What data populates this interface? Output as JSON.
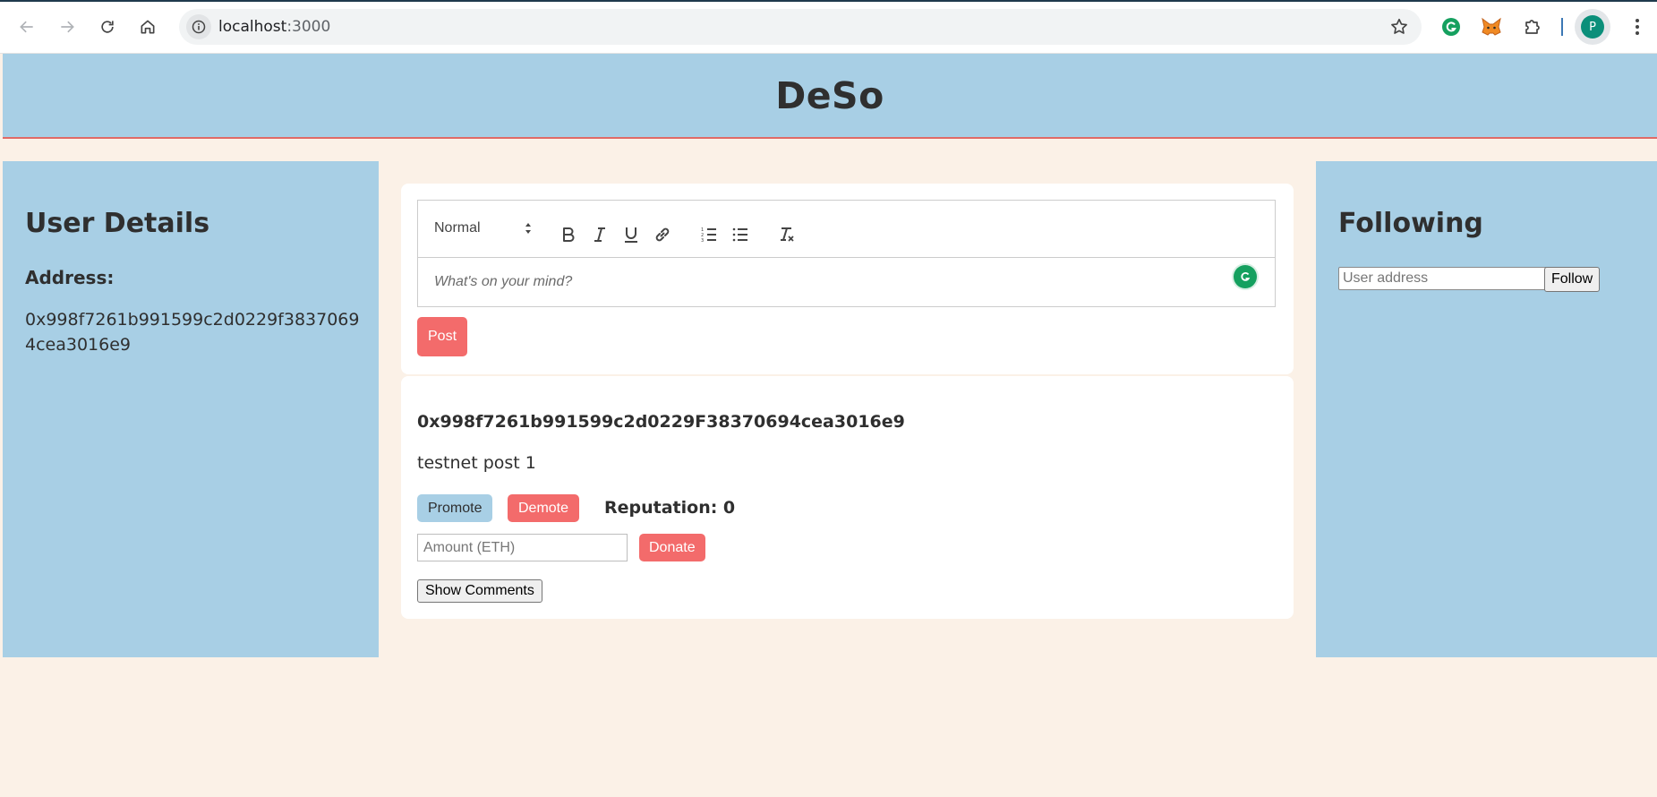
{
  "browser": {
    "url_host": "localhost",
    "url_port": ":3000",
    "profile_initial": "P"
  },
  "header": {
    "title": "DeSo"
  },
  "user_details": {
    "title": "User Details",
    "address_label": "Address:",
    "address_value": "0x998f7261b991599c2d0229f38370694cea3016e9"
  },
  "composer": {
    "format_option": "Normal",
    "placeholder": "What's on your mind?",
    "post_label": "Post",
    "toolbar_icons": [
      "bold-icon",
      "italic-icon",
      "underline-icon",
      "link-icon",
      "ordered-list-icon",
      "bullet-list-icon",
      "clear-format-icon"
    ]
  },
  "posts": [
    {
      "author": "0x998f7261b991599c2d0229F38370694cea3016e9",
      "content": "testnet post 1",
      "promote_label": "Promote",
      "demote_label": "Demote",
      "reputation": "Reputation: 0",
      "amount_placeholder": "Amount (ETH)",
      "donate_label": "Donate",
      "comments_label": "Show Comments"
    }
  ],
  "following": {
    "title": "Following",
    "input_placeholder": "User address",
    "follow_label": "Follow"
  },
  "colors": {
    "panel_blue": "#a8cfe5",
    "accent_red": "#f36b6b",
    "page_bg": "#fbf1e7"
  }
}
